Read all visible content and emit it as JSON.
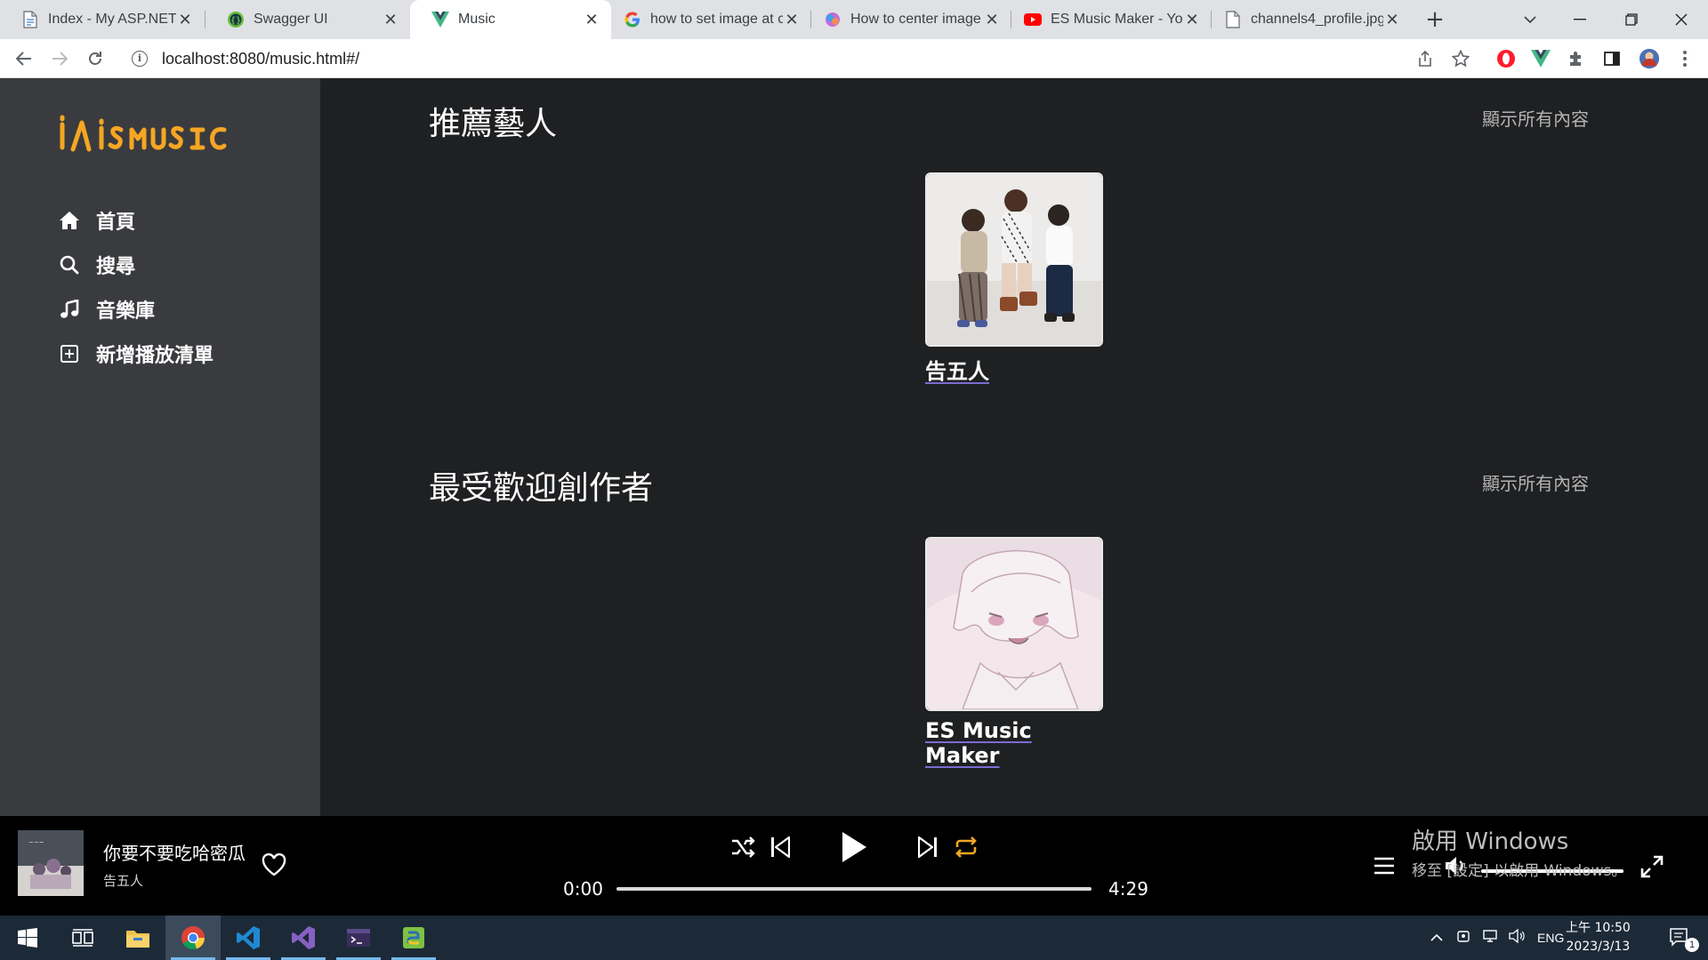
{
  "browser": {
    "tabs": [
      {
        "title": "Index - My ASP.NET Application",
        "favicon": "document-icon"
      },
      {
        "title": "Swagger UI",
        "favicon": "swagger-icon"
      },
      {
        "title": "Music",
        "favicon": "vue-icon"
      },
      {
        "title": "how to set image at center",
        "favicon": "google-icon"
      },
      {
        "title": "How to center image",
        "favicon": "copilot-icon"
      },
      {
        "title": "ES Music Maker - YouTube",
        "favicon": "youtube-icon"
      },
      {
        "title": "channels4_profile.jpg",
        "favicon": "document-icon"
      }
    ],
    "url": "localhost:8080/music.html#/"
  },
  "sidebar": {
    "logo": "iSMUSIC",
    "items": [
      {
        "label": "首頁",
        "icon": "home-icon"
      },
      {
        "label": "搜尋",
        "icon": "search-icon"
      },
      {
        "label": "音樂庫",
        "icon": "music-note-icon"
      },
      {
        "label": "新增播放清單",
        "icon": "add-square-icon"
      }
    ]
  },
  "sections": [
    {
      "title": "推薦藝人",
      "show_all": "顯示所有內容",
      "artist": "告五人"
    },
    {
      "title": "最受歡迎創作者",
      "show_all": "顯示所有內容",
      "artist": "ES Music Maker"
    }
  ],
  "player": {
    "song_title": "你要不要吃哈密瓜",
    "song_artist": "告五人",
    "current_time": "0:00",
    "duration": "4:29",
    "progress": 0,
    "volume": 1.0
  },
  "watermark": {
    "line1": "啟用 Windows",
    "line2": "移至 [設定] 以啟用 Windows。"
  },
  "taskbar": {
    "language": "ENG",
    "time": "上午 10:50",
    "date": "2023/3/13",
    "notifications": "1"
  },
  "colors": {
    "sidebar_bg": "#3a3b3f",
    "main_bg": "#1f2022",
    "player_bg": "#000000",
    "logo_orange": "#f5a623",
    "accent_orange": "#f5a623"
  }
}
